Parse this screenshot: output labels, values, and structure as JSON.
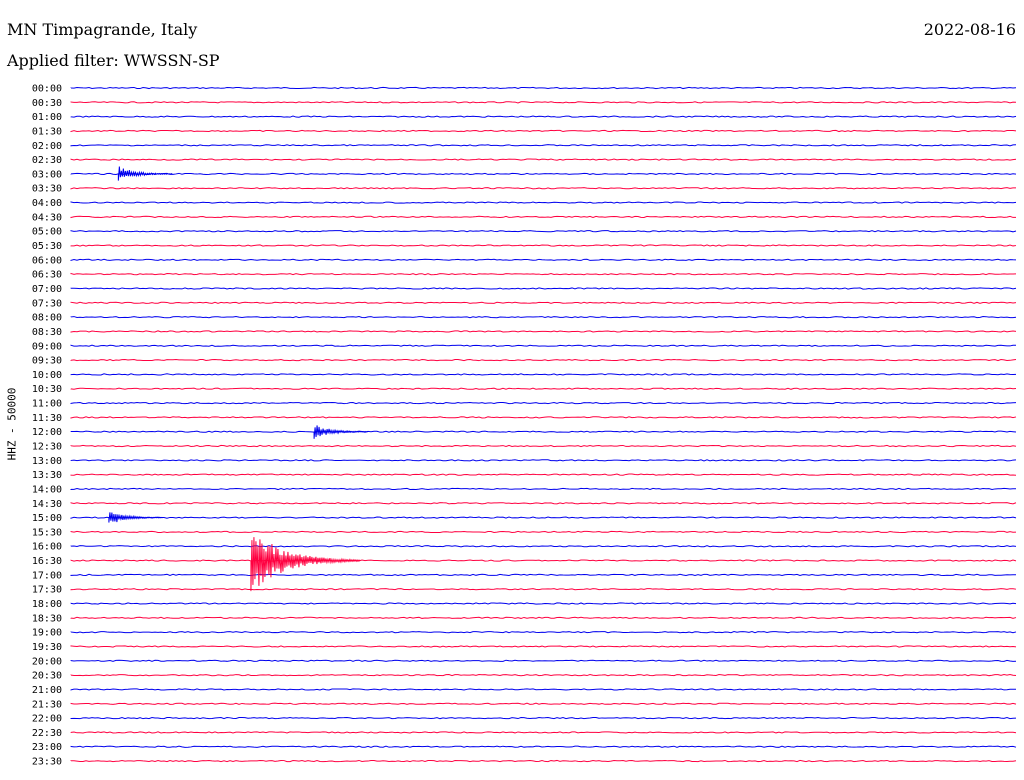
{
  "header": {
    "station": "MN Timpagrande, Italy",
    "date": "2022-08-16",
    "filter": "Applied filter: WWSSN-SP"
  },
  "axis_label": "HHZ - 50000",
  "colors": {
    "blue": "#0000ee",
    "red": "#ff0040"
  },
  "chart_data": {
    "type": "line",
    "title": "MN Timpagrande, Italy",
    "ylabel": "HHZ - 50000",
    "row_labels": [
      "00:00",
      "00:30",
      "01:00",
      "01:30",
      "02:00",
      "02:30",
      "03:00",
      "03:30",
      "04:00",
      "04:30",
      "05:00",
      "05:30",
      "06:00",
      "06:30",
      "07:00",
      "07:30",
      "08:00",
      "08:30",
      "09:00",
      "09:30",
      "10:00",
      "10:30",
      "11:00",
      "11:30",
      "12:00",
      "12:30",
      "13:00",
      "13:30",
      "14:00",
      "14:30",
      "15:00",
      "15:30",
      "16:00",
      "16:30",
      "17:00",
      "17:30",
      "18:00",
      "18:30",
      "19:00",
      "19:30",
      "20:00",
      "20:30",
      "21:00",
      "21:30",
      "22:00",
      "22:30",
      "23:00",
      "23:30"
    ],
    "row_colors": [
      "blue",
      "red"
    ],
    "grid": false,
    "events": [
      {
        "row": "03:00",
        "minute": 1.5,
        "amplitude": "small",
        "color": "blue"
      },
      {
        "row": "16:30",
        "minute": 5.7,
        "amplitude": "large",
        "color": "red"
      },
      {
        "row": "15:00",
        "minute": 1.2,
        "amplitude": "small",
        "color": "blue"
      },
      {
        "row": "12:00",
        "minute": 7.7,
        "amplitude": "small",
        "color": "blue"
      }
    ]
  }
}
